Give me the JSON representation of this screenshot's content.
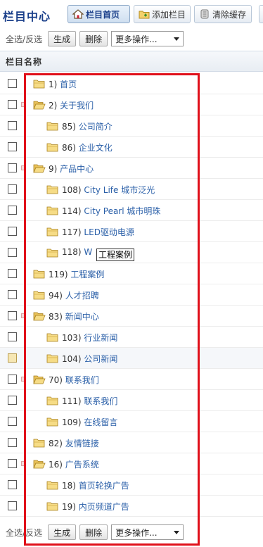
{
  "header": {
    "title": "栏目中心",
    "buttons": [
      {
        "label": "栏目首页",
        "icon": "home-icon"
      },
      {
        "label": "添加栏目",
        "icon": "add-folder-icon"
      },
      {
        "label": "清除缓存",
        "icon": "cache-icon"
      }
    ]
  },
  "toolbar": {
    "select_all": "全选",
    "separator": "/",
    "invert": "反选",
    "generate": "生成",
    "delete": "删除",
    "more_actions": "更多操作..."
  },
  "table": {
    "column_header": "栏目名称",
    "rows": [
      {
        "num": "1)",
        "name": "首页",
        "level": 0,
        "expandable": false,
        "highlighted": false
      },
      {
        "num": "2)",
        "name": "关于我们",
        "level": 0,
        "expandable": true,
        "highlighted": false
      },
      {
        "num": "85)",
        "name": "公司简介",
        "level": 1,
        "expandable": false,
        "highlighted": false
      },
      {
        "num": "86)",
        "name": "企业文化",
        "level": 1,
        "expandable": false,
        "highlighted": false
      },
      {
        "num": "9)",
        "name": "产品中心",
        "level": 0,
        "expandable": true,
        "highlighted": false
      },
      {
        "num": "108)",
        "name": "City Life 城市泛光",
        "level": 1,
        "expandable": false,
        "highlighted": false
      },
      {
        "num": "114)",
        "name": "City Pearl 城市明珠",
        "level": 1,
        "expandable": false,
        "highlighted": false
      },
      {
        "num": "117)",
        "name": "LED驱动电源",
        "level": 1,
        "expandable": false,
        "highlighted": false
      },
      {
        "num": "118)",
        "name": "W",
        "level": 1,
        "expandable": false,
        "highlighted": false
      },
      {
        "num": "119)",
        "name": "工程案例",
        "level": 0,
        "expandable": false,
        "highlighted": false
      },
      {
        "num": "94)",
        "name": "人才招聘",
        "level": 0,
        "expandable": false,
        "highlighted": false
      },
      {
        "num": "83)",
        "name": "新闻中心",
        "level": 0,
        "expandable": true,
        "highlighted": false
      },
      {
        "num": "103)",
        "name": "行业新闻",
        "level": 1,
        "expandable": false,
        "highlighted": false
      },
      {
        "num": "104)",
        "name": "公司新闻",
        "level": 1,
        "expandable": false,
        "highlighted": true
      },
      {
        "num": "70)",
        "name": "联系我们",
        "level": 0,
        "expandable": true,
        "highlighted": false
      },
      {
        "num": "111)",
        "name": "联系我们",
        "level": 1,
        "expandable": false,
        "highlighted": false
      },
      {
        "num": "109)",
        "name": "在线留言",
        "level": 1,
        "expandable": false,
        "highlighted": false
      },
      {
        "num": "82)",
        "name": "友情链接",
        "level": 0,
        "expandable": false,
        "highlighted": false
      },
      {
        "num": "16)",
        "name": "广告系统",
        "level": 0,
        "expandable": true,
        "highlighted": false
      },
      {
        "num": "18)",
        "name": "首页轮换广告",
        "level": 1,
        "expandable": false,
        "highlighted": false
      },
      {
        "num": "19)",
        "name": "内页频道广告",
        "level": 1,
        "expandable": false,
        "highlighted": false
      }
    ]
  },
  "tooltip": {
    "text": "工程案例"
  },
  "colors": {
    "accent": "#1a3f8a",
    "link": "#2a5fa8",
    "highlight_box": "#e0101a"
  }
}
